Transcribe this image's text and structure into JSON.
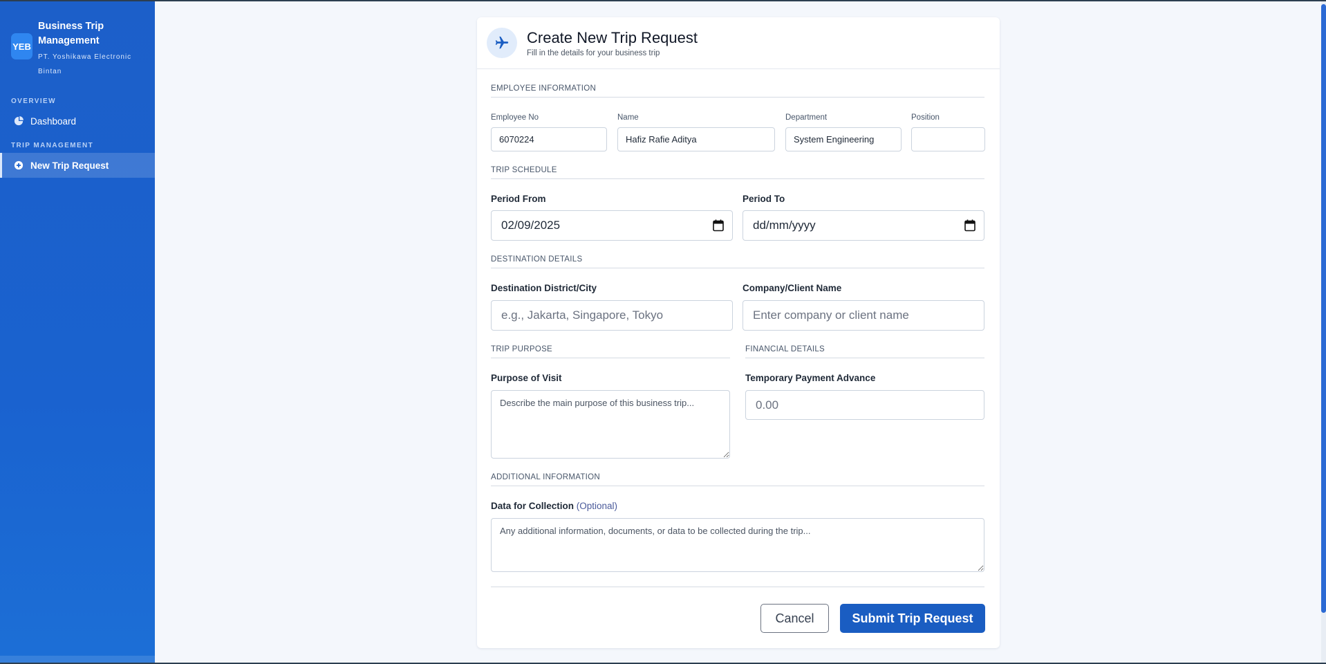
{
  "sidebar": {
    "logo_text": "YEB",
    "title": "Business Trip Management",
    "subtitle": "PT. Yoshikawa Electronic Bintan",
    "sections": {
      "overview": "OVERVIEW",
      "trip_management": "TRIP MANAGEMENT"
    },
    "items": [
      {
        "label": "Dashboard",
        "icon": "pie-chart-icon",
        "active": false
      },
      {
        "label": "New Trip Request",
        "icon": "plus-circle-icon",
        "active": true
      }
    ]
  },
  "header": {
    "icon": "airplane-icon",
    "title": "Create New Trip Request",
    "subtitle": "Fill in the details for your business trip"
  },
  "employee": {
    "section": "EMPLOYEE INFORMATION",
    "employee_no_label": "Employee No",
    "employee_no": "6070224",
    "name_label": "Name",
    "name": "Hafiz Rafie Aditya",
    "department_label": "Department",
    "department": "System Engineering",
    "position_label": "Position",
    "position": ""
  },
  "schedule": {
    "section": "TRIP SCHEDULE",
    "from_label": "Period From",
    "from_value": "02/09/2025",
    "to_label": "Period To",
    "to_placeholder": "dd/mm/yyyy"
  },
  "destination": {
    "section": "DESTINATION DETAILS",
    "city_label": "Destination District/City",
    "city_placeholder": "e.g., Jakarta, Singapore, Tokyo",
    "company_label": "Company/Client Name",
    "company_placeholder": "Enter company or client name"
  },
  "purpose": {
    "section": "TRIP PURPOSE",
    "label": "Purpose of Visit",
    "placeholder": "Describe the main purpose of this business trip..."
  },
  "financial": {
    "section": "FINANCIAL DETAILS",
    "label": "Temporary Payment Advance",
    "placeholder": "0.00"
  },
  "additional": {
    "section": "ADDITIONAL INFORMATION",
    "label": "Data for Collection",
    "optional": "(Optional)",
    "placeholder": "Any additional information, documents, or data to be collected during the trip..."
  },
  "actions": {
    "cancel": "Cancel",
    "submit": "Submit Trip Request"
  },
  "colors": {
    "sidebar": "#1a62cf",
    "primary": "#1a5dc2",
    "background": "#f4f7fc"
  }
}
